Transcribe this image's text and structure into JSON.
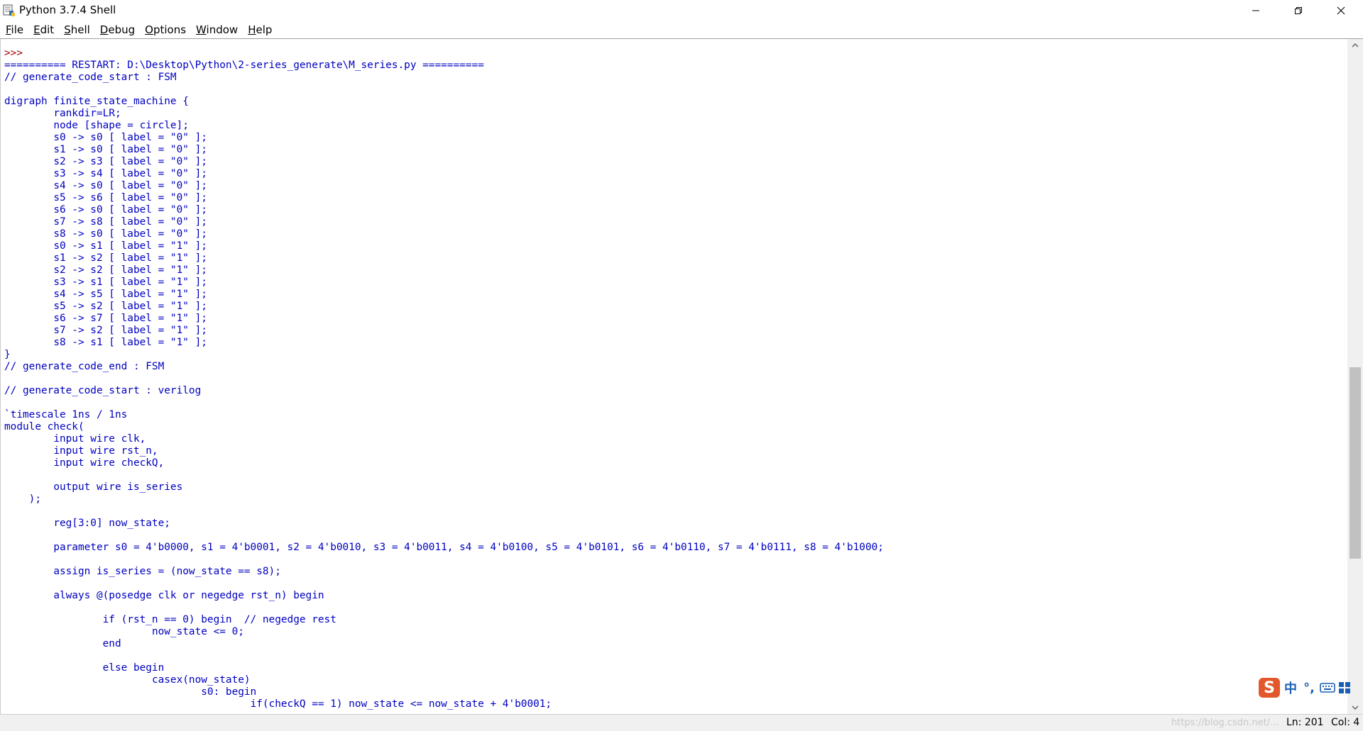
{
  "window": {
    "title": "Python 3.7.4 Shell",
    "accent_color": "#0000c0",
    "prompt_color": "#a00000"
  },
  "menu": [
    {
      "label": "File",
      "mnemonic": "F",
      "rest": "ile"
    },
    {
      "label": "Edit",
      "mnemonic": "E",
      "rest": "dit"
    },
    {
      "label": "Shell",
      "mnemonic": "S",
      "rest": "hell"
    },
    {
      "label": "Debug",
      "mnemonic": "D",
      "rest": "ebug"
    },
    {
      "label": "Options",
      "mnemonic": "O",
      "rest": "ptions"
    },
    {
      "label": "Window",
      "mnemonic": "W",
      "rest": "indow"
    },
    {
      "label": "Help",
      "mnemonic": "H",
      "rest": "elp"
    }
  ],
  "shell": {
    "prompt": ">>>",
    "lines": [
      "========== RESTART: D:\\Desktop\\Python\\2-series_generate\\M_series.py ==========",
      "// generate_code_start : FSM",
      "",
      "digraph finite_state_machine {",
      "\trankdir=LR;",
      "\tnode [shape = circle];",
      "\ts0 -> s0 [ label = \"0\" ];",
      "\ts1 -> s0 [ label = \"0\" ];",
      "\ts2 -> s3 [ label = \"0\" ];",
      "\ts3 -> s4 [ label = \"0\" ];",
      "\ts4 -> s0 [ label = \"0\" ];",
      "\ts5 -> s6 [ label = \"0\" ];",
      "\ts6 -> s0 [ label = \"0\" ];",
      "\ts7 -> s8 [ label = \"0\" ];",
      "\ts8 -> s0 [ label = \"0\" ];",
      "\ts0 -> s1 [ label = \"1\" ];",
      "\ts1 -> s2 [ label = \"1\" ];",
      "\ts2 -> s2 [ label = \"1\" ];",
      "\ts3 -> s1 [ label = \"1\" ];",
      "\ts4 -> s5 [ label = \"1\" ];",
      "\ts5 -> s2 [ label = \"1\" ];",
      "\ts6 -> s7 [ label = \"1\" ];",
      "\ts7 -> s2 [ label = \"1\" ];",
      "\ts8 -> s1 [ label = \"1\" ];",
      "}",
      "// generate_code_end : FSM",
      "",
      "// generate_code_start : verilog",
      "",
      "`timescale 1ns / 1ns",
      "module check(",
      "\tinput wire clk,",
      "\tinput wire rst_n,",
      "\tinput wire checkQ,",
      "",
      "\toutput wire is_series",
      "    );",
      "",
      "\treg[3:0] now_state;",
      "",
      "\tparameter s0 = 4'b0000, s1 = 4'b0001, s2 = 4'b0010, s3 = 4'b0011, s4 = 4'b0100, s5 = 4'b0101, s6 = 4'b0110, s7 = 4'b0111, s8 = 4'b1000;",
      "",
      "\tassign is_series = (now_state == s8);",
      "",
      "\talways @(posedge clk or negedge rst_n) begin",
      "",
      "\t\tif (rst_n == 0) begin  // negedge rest",
      "\t\t\tnow_state <= 0;",
      "\t\tend",
      "",
      "\t\telse begin",
      "\t\t\tcasex(now_state)",
      "\t\t\t\ts0: begin",
      "\t\t\t\t\tif(checkQ == 1) now_state <= now_state + 4'b0001;"
    ]
  },
  "status": {
    "watermark": "https://blog.csdn.net/...",
    "ln": "Ln: 201",
    "col": "Col: 4"
  },
  "ime": {
    "logo": "S",
    "lang": "中",
    "punct": "°,",
    "keyboard": "keyboard-icon",
    "grid": "grid-icon"
  }
}
